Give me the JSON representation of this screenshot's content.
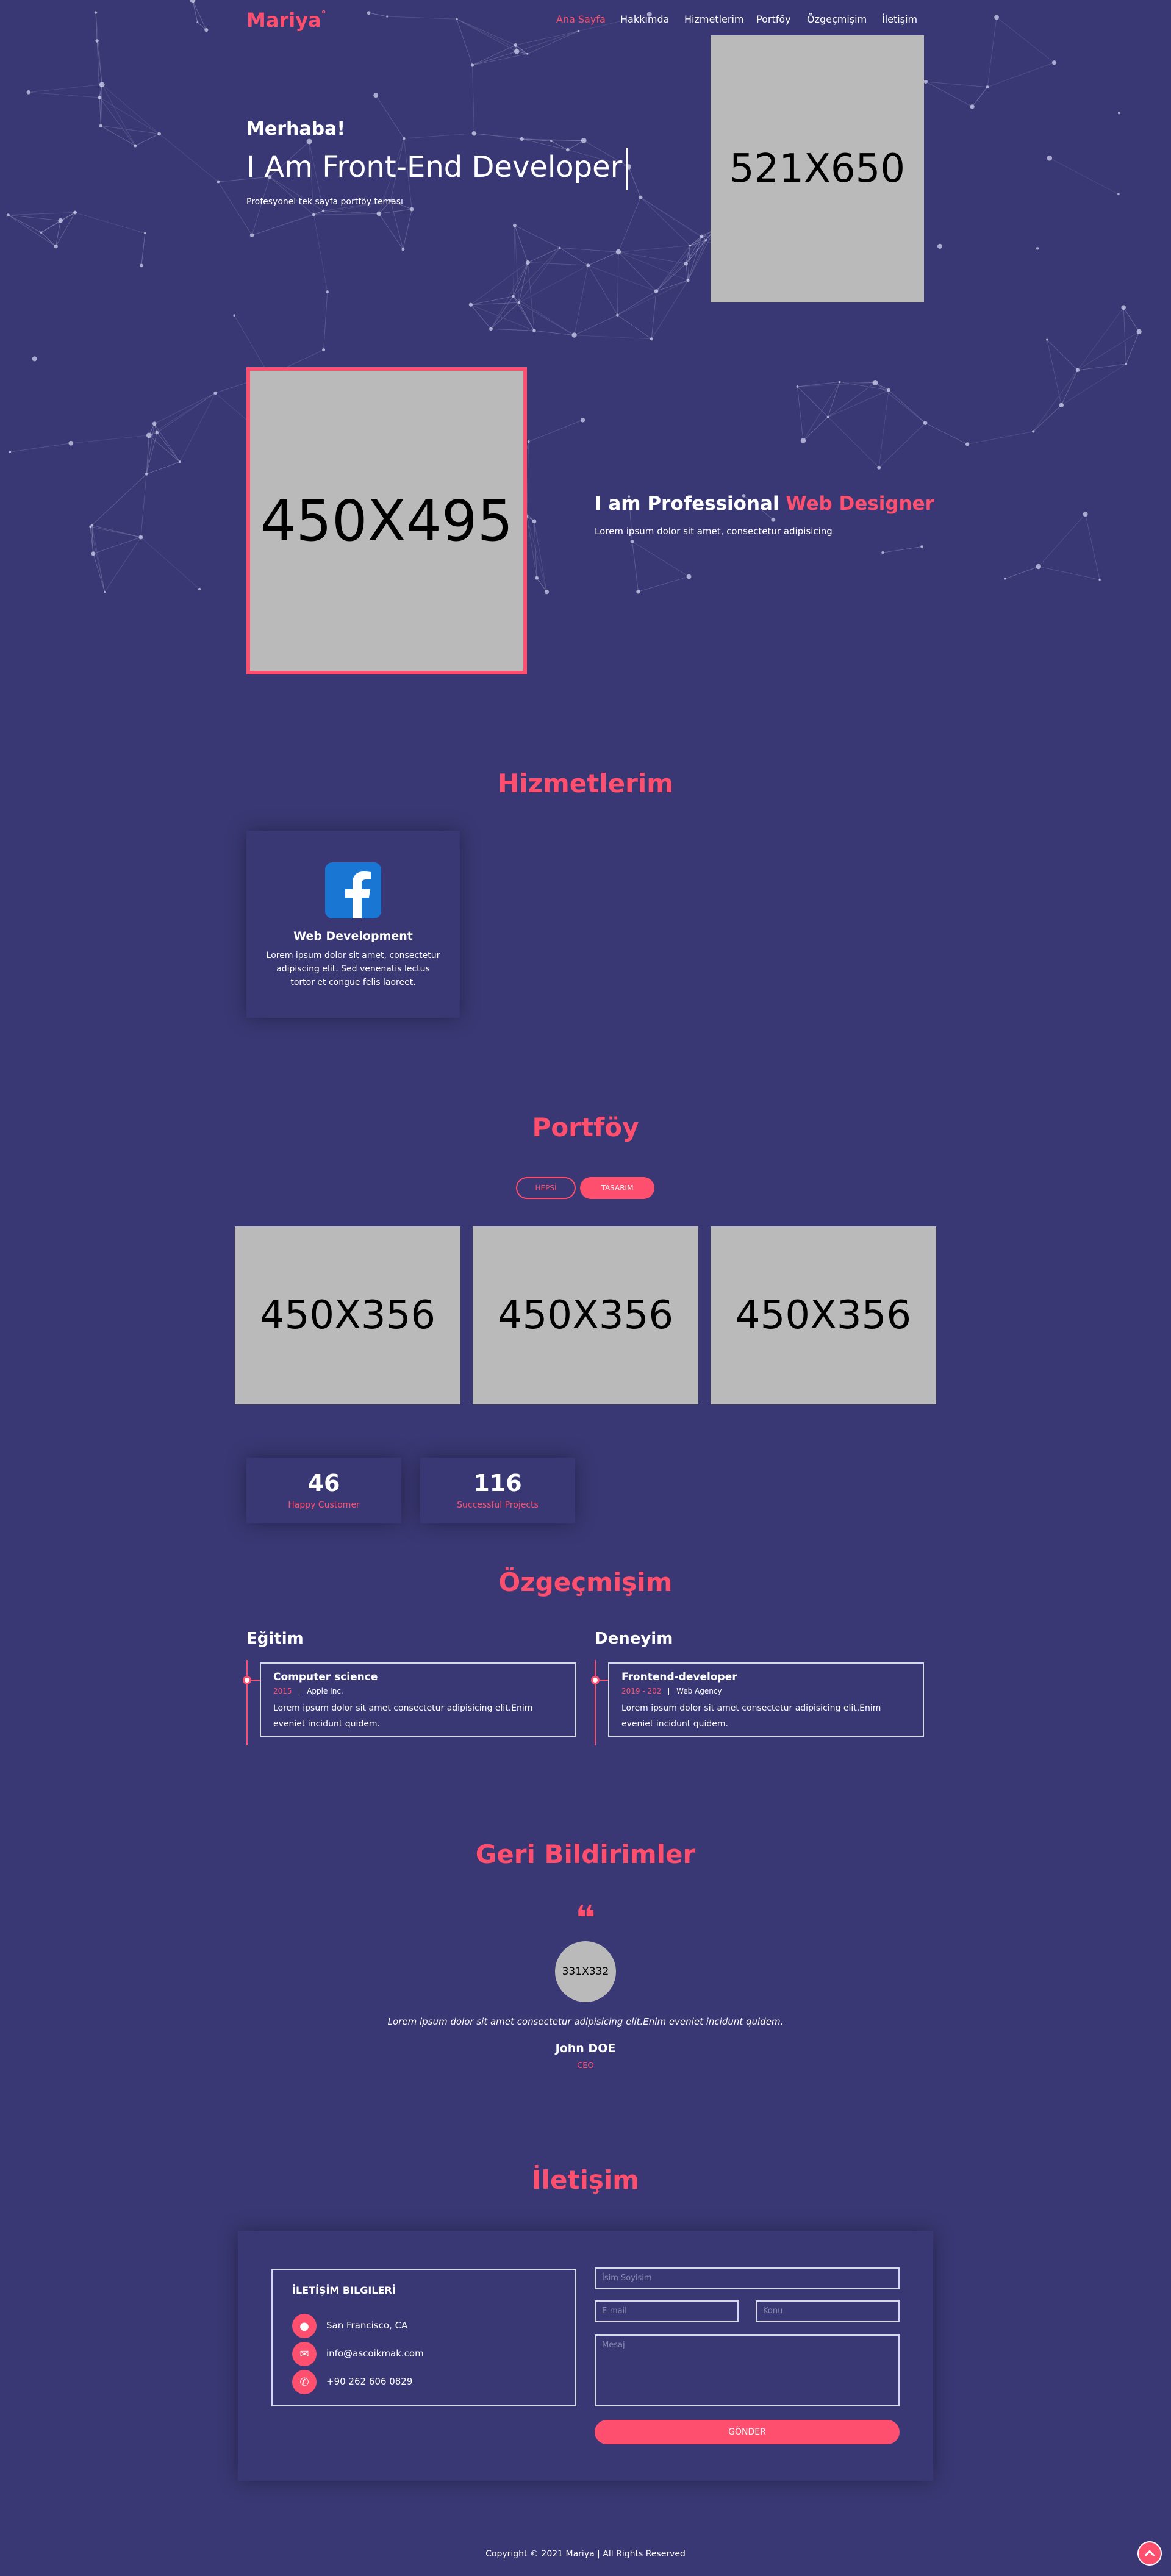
{
  "colors": {
    "background": "#3a3874",
    "accent": "#ff4f6e",
    "placeholder": "#bababa"
  },
  "header": {
    "logo": "Mariya",
    "nav": [
      "Ana Sayfa",
      "Hakkımda",
      "Hizmetlerim",
      "Portföy",
      "Özgeçmişim",
      "İletişim"
    ],
    "active_nav": "Ana Sayfa"
  },
  "hero": {
    "greeting": "Merhaba!",
    "headline": "I Am Front-End Developer",
    "subtitle": "Profesyonel tek sayfa portföy teması",
    "image_label": "521X650"
  },
  "about": {
    "image_label": "450X495",
    "title_prefix": "I am Professional ",
    "title_accent": "Web Designer",
    "text": "Lorem ipsum dolor sit amet, consectetur adipisicing"
  },
  "services": {
    "title": "Hizmetlerim",
    "items": [
      {
        "icon": "facebook-icon",
        "title": "Web Development",
        "text": "Lorem ipsum dolor sit amet, consectetur adipiscing elit. Sed venenatis lectus tortor et congue felis laoreet."
      }
    ]
  },
  "portfolio": {
    "title": "Portföy",
    "filters": [
      "HEPSİ",
      "TASARIM"
    ],
    "active_filter": "TASARIM",
    "items": [
      "450X356",
      "450X356",
      "450X356"
    ]
  },
  "stats": [
    {
      "number": "46",
      "label": "Happy Customer"
    },
    {
      "number": "116",
      "label": "Successful Projects"
    }
  ],
  "resume": {
    "title": "Özgeçmişim",
    "education": {
      "heading": "Eğitim",
      "title": "Computer science",
      "years": "2015",
      "place": "Apple Inc.",
      "text": "Lorem ipsum dolor sit amet consectetur adipisicing elit.Enim eveniet incidunt quidem."
    },
    "experience": {
      "heading": "Deneyim",
      "title": "Frontend-developer",
      "years": "2019 - 202",
      "place": "Web Agency",
      "text": "Lorem ipsum dolor sit amet consectetur adipisicing elit.Enim eveniet incidunt quidem."
    }
  },
  "testimonials": {
    "title": "Geri Bildirimler",
    "quote_icon": "quote-icon",
    "avatar_label": "331X332",
    "text": "Lorem ipsum dolor sit amet consectetur adipisicing elit.Enim eveniet incidunt quidem.",
    "name": "John DOE",
    "role": "CEO"
  },
  "contact": {
    "title": "İletişim",
    "info_heading": "İLETİŞİM BILGILERİ",
    "address": "San Francisco, CA",
    "email": "info@ascoikmak.com",
    "phone": "+90 262 606 0829",
    "name_placeholder": "İsim Soyisim",
    "email_placeholder": "E-mail",
    "subject_placeholder": "Konu",
    "message_placeholder": "Mesaj",
    "submit_label": "GÖNDER"
  },
  "footer": {
    "copyright": "Copyright © 2021 Mariya | All Rights Reserved"
  }
}
